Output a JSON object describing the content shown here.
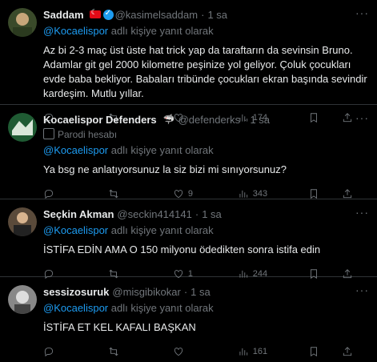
{
  "tweets": [
    {
      "name": "Saddam",
      "handle": "@kasimelsaddam",
      "time": "1 sa",
      "reply_to": "@Kocaelispor",
      "reply_suffix": "adlı kişiye yanıt olarak",
      "text": "Az bi 2-3 maç üst üste hat trick yap da taraftarın da sevinsin Bruno. Adamlar git gel 2000 kilometre peşinize yol geliyor. Çoluk çocukları evde baba bekliyor. Babaları tribünde çocukları ekran başında sevindir kardeşim. Mutlu yıllar.",
      "replies": "",
      "retweets": "",
      "likes": "",
      "views": "174"
    },
    {
      "name": "Kocaelispor Defenders",
      "handle": "@defenderks",
      "time": "1 sa",
      "parody": "Parodi hesabı",
      "reply_to": "@Kocaelispor",
      "reply_suffix": "adlı kişiye yanıt olarak",
      "text": "Ya bsg ne anlatıyorsunuz la siz bizi mi sınıyorsunuz?",
      "replies": "",
      "retweets": "",
      "likes": "9",
      "views": "343"
    },
    {
      "name": "Seçkin Akman",
      "handle": "@seckin414141",
      "time": "1 sa",
      "reply_to": "@Kocaelispor",
      "reply_suffix": "adlı kişiye yanıt olarak",
      "text": "İSTİFA EDİN AMA O 150 milyonu ödedikten sonra istifa edin",
      "replies": "",
      "retweets": "",
      "likes": "1",
      "views": "244"
    },
    {
      "name": "sessizosuruk",
      "handle": "@misgibikokar",
      "time": "1 sa",
      "reply_to": "@Kocaelispor",
      "reply_suffix": "adlı kişiye yanıt olarak",
      "text": "İSTİFA ET KEL KAFALI BAŞKAN",
      "replies": "",
      "retweets": "",
      "likes": "",
      "views": "161"
    }
  ],
  "sep": "·",
  "more": "···"
}
